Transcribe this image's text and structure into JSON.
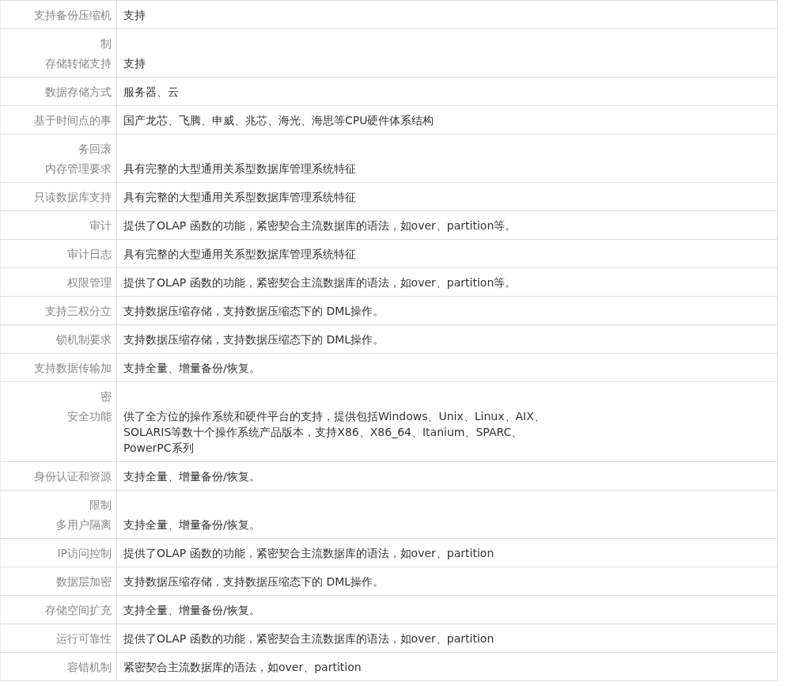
{
  "rows": [
    {
      "label": "支持备份压缩机",
      "value": [
        "支持"
      ]
    },
    {
      "carry": "制",
      "label": "存储转储支持",
      "value": [
        "支持"
      ]
    },
    {
      "label": "数据存储方式",
      "value": [
        "服务器、云"
      ]
    },
    {
      "label": "基于时间点的事",
      "value": [
        "国产龙芯、飞腾、申威、兆芯、海光、海思等CPU硬件体系结构"
      ]
    },
    {
      "carry": "务回滚",
      "label": "内存管理要求",
      "value": [
        "具有完整的大型通用关系型数据库管理系统特征"
      ]
    },
    {
      "label": "只读数据库支持",
      "value": [
        "具有完整的大型通用关系型数据库管理系统特征"
      ]
    },
    {
      "label": "审计",
      "value": [
        "提供了OLAP 函数的功能，紧密契合主流数据库的语法，如over、partition等。"
      ]
    },
    {
      "label": "审计日志",
      "value": [
        "具有完整的大型通用关系型数据库管理系统特征"
      ]
    },
    {
      "label": "权限管理",
      "value": [
        "提供了OLAP 函数的功能，紧密契合主流数据库的语法，如over、partition等。"
      ]
    },
    {
      "label": "支持三权分立",
      "value": [
        "支持数据压缩存储，支持数据压缩态下的 DML操作。"
      ]
    },
    {
      "label": "锁机制要求",
      "value": [
        "支持数据压缩存储，支持数据压缩态下的 DML操作。"
      ]
    },
    {
      "label": "支持数据传输加",
      "value": [
        "支持全量、增量备份/恢复。"
      ]
    },
    {
      "carry": "密",
      "label": "安全功能",
      "value": [
        "供了全方位的操作系统和硬件平台的支持，提供包括Windows、Unix、Linux、AIX、",
        "SOLARIS等数十个操作系统产品版本，支持X86、X86_64、Itanium、SPARC、",
        "PowerPC系列"
      ]
    },
    {
      "label": "身份认证和资源",
      "value": [
        "支持全量、增量备份/恢复。"
      ]
    },
    {
      "carry": "限制",
      "label": "多用户隔离",
      "value": [
        "支持全量、增量备份/恢复。"
      ]
    },
    {
      "label": "IP访问控制",
      "value": [
        "提供了OLAP 函数的功能，紧密契合主流数据库的语法，如over、partition"
      ]
    },
    {
      "label": "数据层加密",
      "value": [
        "支持数据压缩存储，支持数据压缩态下的 DML操作。"
      ]
    },
    {
      "label": "存储空间扩充",
      "value": [
        "支持全量、增量备份/恢复。"
      ]
    },
    {
      "label": "运行可靠性",
      "value": [
        "提供了OLAP 函数的功能，紧密契合主流数据库的语法，如over、partition"
      ]
    },
    {
      "label": "容错机制",
      "value": [
        "紧密契合主流数据库的语法，如over、partition"
      ]
    }
  ]
}
